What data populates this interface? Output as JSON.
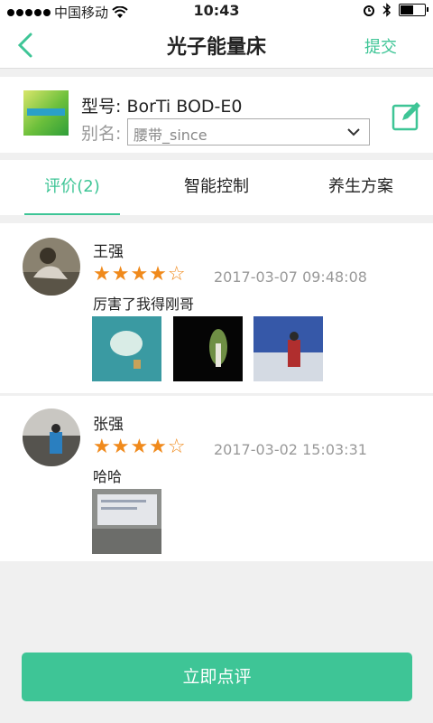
{
  "status_bar": {
    "carrier": "中国移动",
    "time": "10:43"
  },
  "nav": {
    "title": "光子能量床",
    "submit_label": "提交"
  },
  "device": {
    "model": "型号: BorTi BOD-E0",
    "alias_label": "别名:",
    "alias_value": "腰带_since"
  },
  "tabs": [
    {
      "label": "评价(2)",
      "active": true
    },
    {
      "label": "智能控制",
      "active": false
    },
    {
      "label": "养生方案",
      "active": false
    }
  ],
  "reviews": [
    {
      "name": "王强",
      "stars": "★★★★☆",
      "date": "2017-03-07 09:48:08",
      "content": "厉害了我得刚哥"
    },
    {
      "name": "张强",
      "stars": "★★★★☆",
      "date": "2017-03-02 15:03:31",
      "content": "哈哈"
    }
  ],
  "cta_label": "立即点评",
  "colors": {
    "accent": "#3ec596",
    "star": "#f08a1c"
  }
}
